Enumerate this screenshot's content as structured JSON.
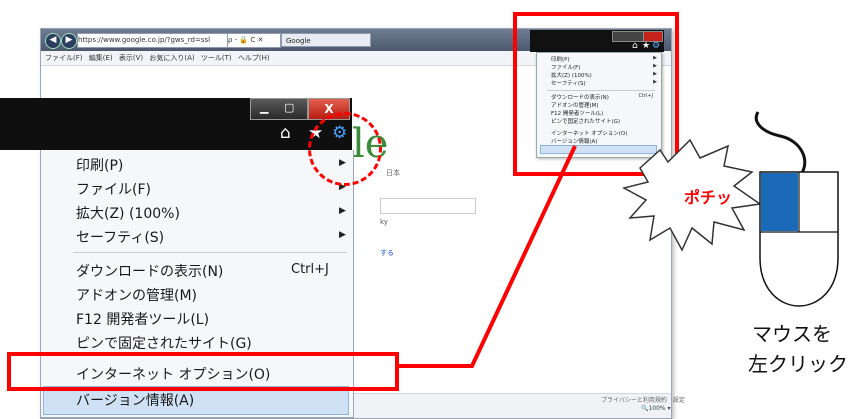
{
  "background_browser": {
    "address": "https://www.google.co.jp/?gws_rd=ssl",
    "address_tools": "ρ - 🔒 C ✕",
    "tab_title": "Google",
    "menubar": [
      "ファイル(F)",
      "編集(E)",
      "表示(V)",
      "お気に入り(A)",
      "ツール(T)",
      "ヘルプ(H)"
    ],
    "logo_text": "le",
    "country": "日本",
    "search_button": "ky",
    "link_text": "する",
    "footer_links": "プライバシーと利用規約　設定",
    "zoom_level": "🔍100% ▾"
  },
  "small_menu": {
    "items": [
      {
        "label": "印刷(P)",
        "arrow": "▶"
      },
      {
        "label": "ファイル(F)",
        "arrow": "▶"
      },
      {
        "label": "拡大(Z) (100%)",
        "arrow": "▶"
      },
      {
        "label": "セーフティ(S)",
        "arrow": "▶"
      },
      {
        "label": "ダウンロードの表示(N)",
        "shortcut": "Ctrl+J"
      },
      {
        "label": "アドオンの管理(M)"
      },
      {
        "label": "F12 開発者ツール(L)"
      },
      {
        "label": "ピンで固定されたサイト(G)"
      },
      {
        "label": "インターネット オプション(O)"
      },
      {
        "label": "バージョン情報(A)"
      }
    ]
  },
  "big_menu": {
    "close_glyph": "X",
    "minimize_glyph": "▁",
    "maximize_glyph": "▢",
    "icons": {
      "home": "⌂",
      "favorites": "★",
      "tools": "⚙"
    },
    "items": [
      {
        "label": "印刷(P)",
        "arrow": "▶"
      },
      {
        "label": "ファイル(F)",
        "arrow": "▶"
      },
      {
        "label": "拡大(Z) (100%)",
        "arrow": "▶"
      },
      {
        "label": "セーフティ(S)",
        "arrow": "▶"
      },
      {
        "label": "ダウンロードの表示(N)",
        "shortcut": "Ctrl+J"
      },
      {
        "label": "アドオンの管理(M)"
      },
      {
        "label": "F12 開発者ツール(L)"
      },
      {
        "label": "ピンで固定されたサイト(G)"
      },
      {
        "label": "インターネット オプション(O)"
      },
      {
        "label": "バージョン情報(A)"
      }
    ]
  },
  "annotation": {
    "pochi": "ポチッ",
    "caption_line1": "マウスを",
    "caption_line2": "左クリック",
    "highlight_color": "#ff0000",
    "mouse_button_color": "#1a6ab8"
  }
}
